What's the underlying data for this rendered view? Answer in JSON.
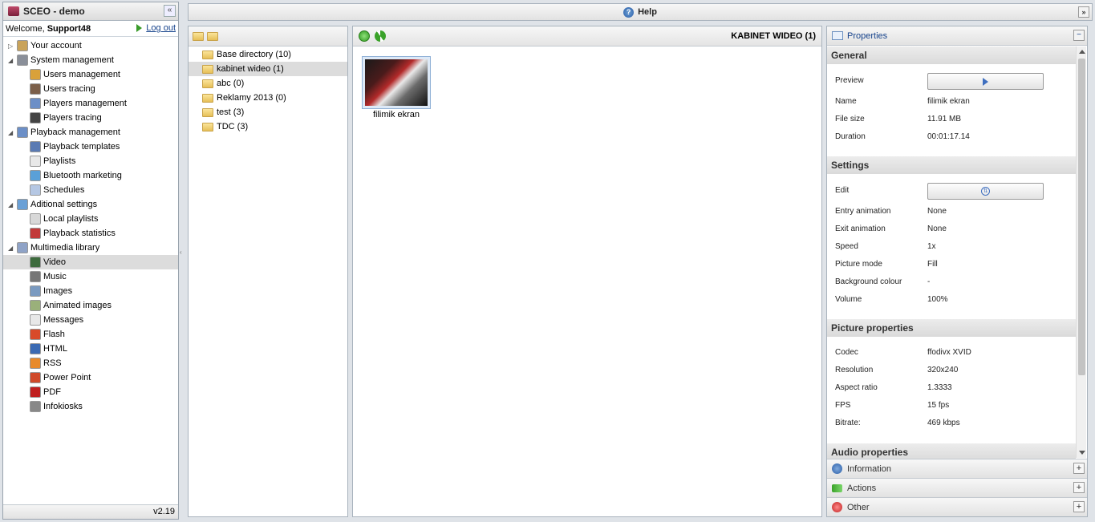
{
  "app": {
    "title": "SCEO - demo",
    "version": "v2.19"
  },
  "welcome": {
    "prefix": "Welcome,",
    "user": "Support48",
    "logout": "Log out"
  },
  "nav": [
    {
      "label": "Your account",
      "level": 0,
      "expander": "▷"
    },
    {
      "label": "System management",
      "level": 0,
      "expander": "◢"
    },
    {
      "label": "Users management",
      "level": 1
    },
    {
      "label": "Users tracing",
      "level": 1
    },
    {
      "label": "Players management",
      "level": 1
    },
    {
      "label": "Players tracing",
      "level": 1
    },
    {
      "label": "Playback management",
      "level": 0,
      "expander": "◢"
    },
    {
      "label": "Playback templates",
      "level": 1
    },
    {
      "label": "Playlists",
      "level": 1
    },
    {
      "label": "Bluetooth marketing",
      "level": 1
    },
    {
      "label": "Schedules",
      "level": 1
    },
    {
      "label": "Aditional settings",
      "level": 0,
      "expander": "◢"
    },
    {
      "label": "Local playlists",
      "level": 1
    },
    {
      "label": "Playback statistics",
      "level": 1
    },
    {
      "label": "Multimedia library",
      "level": 0,
      "expander": "◢"
    },
    {
      "label": "Video",
      "level": 1,
      "selected": true
    },
    {
      "label": "Music",
      "level": 1
    },
    {
      "label": "Images",
      "level": 1
    },
    {
      "label": "Animated images",
      "level": 1
    },
    {
      "label": "Messages",
      "level": 1
    },
    {
      "label": "Flash",
      "level": 1
    },
    {
      "label": "HTML",
      "level": 1
    },
    {
      "label": "RSS",
      "level": 1
    },
    {
      "label": "Power Point",
      "level": 1
    },
    {
      "label": "PDF",
      "level": 1
    },
    {
      "label": "Infokiosks",
      "level": 1
    }
  ],
  "help": {
    "label": "Help"
  },
  "folders": [
    {
      "label": "Base directory (10)",
      "root": true
    },
    {
      "label": "kabinet wideo (1)",
      "selected": true
    },
    {
      "label": "abc (0)"
    },
    {
      "label": "Reklamy 2013 (0)"
    },
    {
      "label": "test (3)"
    },
    {
      "label": "TDC (3)"
    }
  ],
  "content": {
    "title": "KABINET WIDEO (1)",
    "item_caption": "filimik ekran"
  },
  "properties": {
    "header": "Properties",
    "general": {
      "title": "General",
      "rows": [
        {
          "k": "Preview",
          "v": ""
        },
        {
          "k": "Name",
          "v": "filimik ekran"
        },
        {
          "k": "File size",
          "v": "11.91 MB"
        },
        {
          "k": "Duration",
          "v": "00:01:17.14"
        }
      ]
    },
    "settings": {
      "title": "Settings",
      "rows": [
        {
          "k": "Edit",
          "v": ""
        },
        {
          "k": "Entry animation",
          "v": "None"
        },
        {
          "k": "Exit animation",
          "v": "None"
        },
        {
          "k": "Speed",
          "v": "1x"
        },
        {
          "k": "Picture mode",
          "v": "Fill"
        },
        {
          "k": "Background colour",
          "v": "-"
        },
        {
          "k": "Volume",
          "v": "100%"
        }
      ]
    },
    "picture": {
      "title": "Picture properties",
      "rows": [
        {
          "k": "Codec",
          "v": "ffodivx XVID"
        },
        {
          "k": "Resolution",
          "v": "320x240"
        },
        {
          "k": "Aspect ratio",
          "v": "1.3333"
        },
        {
          "k": "FPS",
          "v": "15 fps"
        },
        {
          "k": "Bitrate:",
          "v": "469 kbps"
        }
      ]
    },
    "audio": {
      "title": "Audio properties"
    }
  },
  "accordions": [
    {
      "label": "Information"
    },
    {
      "label": "Actions"
    },
    {
      "label": "Other"
    }
  ],
  "colors": {
    "accent": "#15428b",
    "selection": "#dcdcdc",
    "border": "#a9b3bd"
  }
}
